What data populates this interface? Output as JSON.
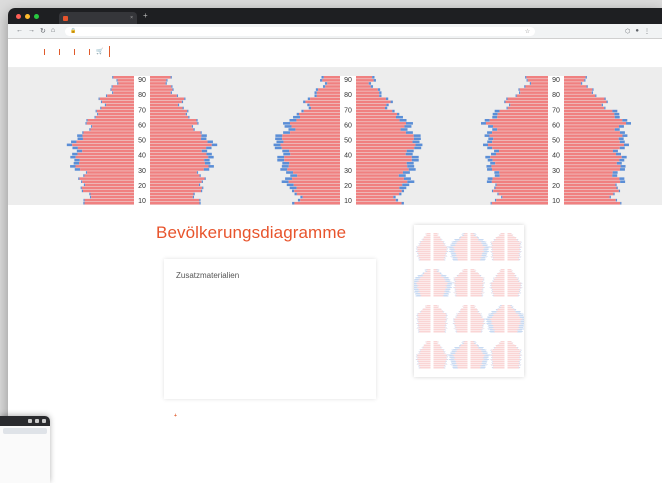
{
  "browser": {
    "tab_title": "",
    "url": "",
    "window_controls": [
      "#ff5f57",
      "#febc2e",
      "#28c840"
    ],
    "icons": [
      "back-icon",
      "forward-icon",
      "reload-icon",
      "home-icon",
      "lock-icon",
      "bookmark-star-icon",
      "extensions-icon",
      "profile-icon",
      "menu-icon"
    ]
  },
  "site": {
    "menu": [
      "",
      "",
      "",
      ""
    ],
    "cart_icon": "cart-icon",
    "lang": "",
    "logo_line1": "",
    "logo_line2": ""
  },
  "hero": {
    "age_labels": [
      "90",
      "80",
      "70",
      "60",
      "50",
      "40",
      "30",
      "20",
      "10"
    ]
  },
  "page": {
    "breadcrumb": "",
    "title": "Bevölkerungsdiagramme"
  },
  "card": {
    "title": "Zusatzmaterialien",
    "items": [
      {
        "heading": "",
        "link": ""
      },
      {
        "heading": "",
        "link": ""
      },
      {
        "heading": "",
        "link": ""
      }
    ]
  },
  "feedback": "",
  "sidebar": {
    "info_heading": "",
    "info_lines": [
      "",
      "",
      "",
      ""
    ],
    "karten_heading": "",
    "karten_lines": [
      "",
      "",
      ""
    ]
  },
  "colors": {
    "accent": "#e8542c",
    "female": "#f08080",
    "male": "#5b8ed6"
  }
}
